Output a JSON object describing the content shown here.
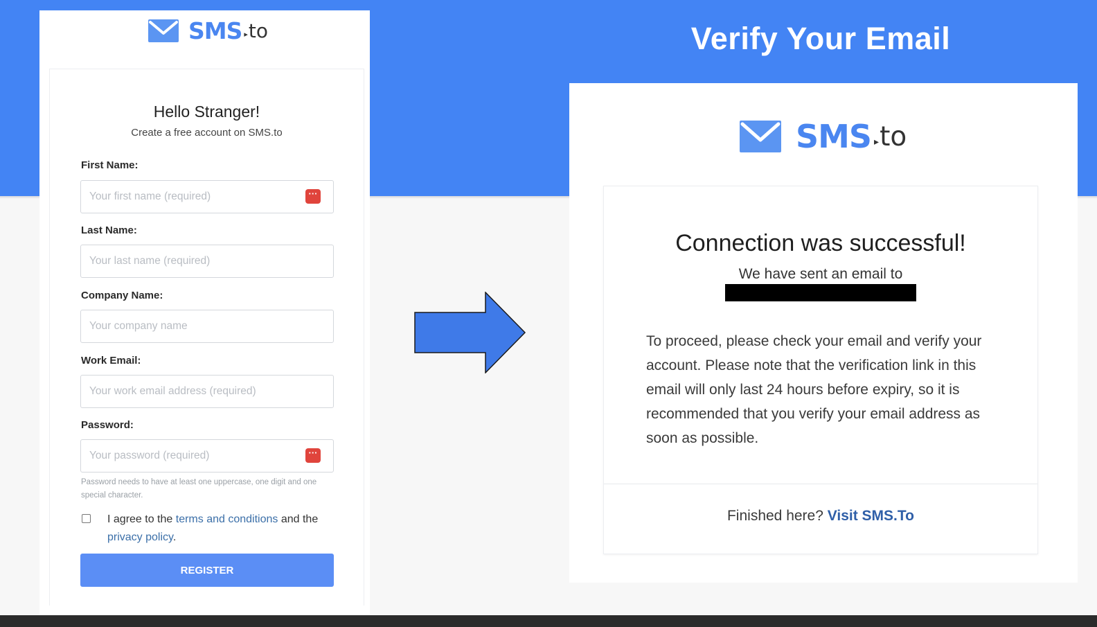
{
  "slide": {
    "title": "Verify Your Email"
  },
  "logo": {
    "brand": "SMS",
    "suffix": "to",
    "icon": "mail-icon",
    "color": "#4a86f0"
  },
  "register_form": {
    "heading": "Hello Stranger!",
    "subheading": "Create a free account on SMS.to",
    "fields": [
      {
        "label": "First Name:",
        "placeholder": "Your first name (required)",
        "password_manager_icon": true
      },
      {
        "label": "Last Name:",
        "placeholder": "Your last name (required)",
        "password_manager_icon": false
      },
      {
        "label": "Company Name:",
        "placeholder": "Your company name",
        "password_manager_icon": false
      },
      {
        "label": "Work Email:",
        "placeholder": "Your work email address (required)",
        "password_manager_icon": false
      },
      {
        "label": "Password:",
        "placeholder": "Your password (required)",
        "password_manager_icon": true
      }
    ],
    "password_hint": "Password needs to have at least one uppercase, one digit and one special character.",
    "agree": {
      "prefix": "I agree to the",
      "terms_link": "terms and conditions",
      "middle": "and the",
      "privacy_link": "privacy policy",
      "suffix": ".",
      "checked": false
    },
    "register_label": "REGISTER",
    "button_color": "#5b8ef5"
  },
  "confirmation": {
    "title": "Connection was successful!",
    "sent_line": "We have sent an email to",
    "body": "To proceed, please check your email and verify your account. Please note that the verification link in this email will only last 24 hours before expiry, so it is recommended that you verify your email address as soon as possible.",
    "finished_prefix": "Finished here?",
    "finished_link": "Visit SMS.To"
  },
  "colors": {
    "header_blue": "#4384f4",
    "arrow_blue": "#3f7ae8",
    "error_icon_red": "#e0443c"
  }
}
